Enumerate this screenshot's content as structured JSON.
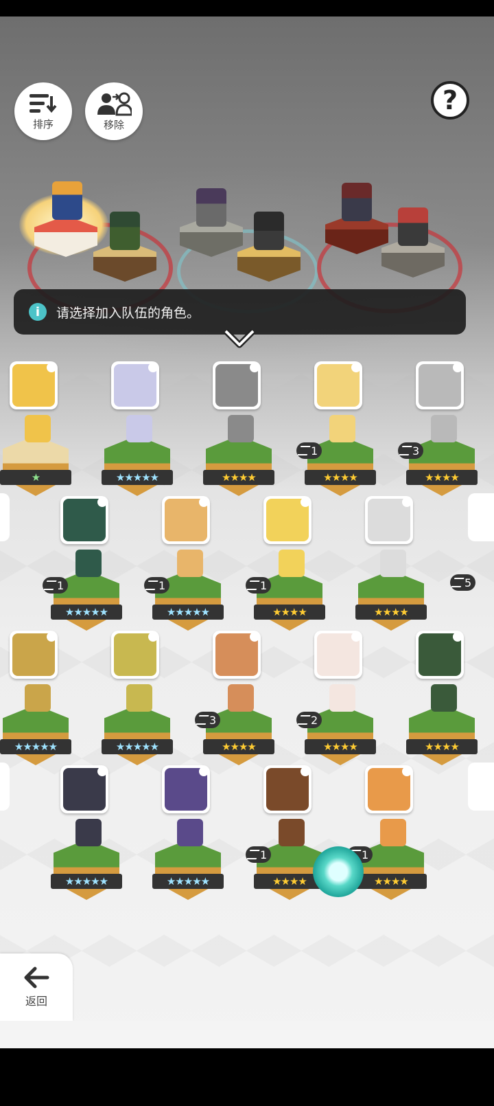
{
  "toolbar": {
    "sort_label": "排序",
    "remove_label": "移除",
    "help_glyph": "?"
  },
  "team_slots": [
    {
      "team_color": "#c8343a",
      "selected": true
    },
    {
      "team_color": "#c8343a",
      "selected": false
    },
    {
      "team_color": "#6fc0c8",
      "selected": false
    },
    {
      "team_color": "#6fc0c8",
      "selected": false
    },
    {
      "team_color": "#c8343a",
      "selected": false
    },
    {
      "team_color": "#c8343a",
      "selected": false
    }
  ],
  "info": {
    "icon": "i",
    "message": "请选择加入队伍的角色。"
  },
  "roster": [
    {
      "stars": "★",
      "star_style": "green",
      "dup": "",
      "base": "sand"
    },
    {
      "stars": "★★★★★",
      "star_style": "rainbow",
      "dup": "",
      "base": "grass"
    },
    {
      "stars": "★★★★",
      "star_style": "gold",
      "dup": "",
      "base": "grass"
    },
    {
      "stars": "★★★★",
      "star_style": "gold",
      "dup": "1",
      "base": "grass"
    },
    {
      "stars": "★★★★",
      "star_style": "gold",
      "dup": "3",
      "base": "grass"
    },
    {
      "stars": "★★★★★",
      "star_style": "rainbow",
      "dup": "1",
      "base": "grass"
    },
    {
      "stars": "★★★★★",
      "star_style": "rainbow",
      "dup": "1",
      "base": "grass"
    },
    {
      "stars": "★★★★",
      "star_style": "gold",
      "dup": "1",
      "base": "grass"
    },
    {
      "stars": "★★★★",
      "star_style": "gold",
      "dup": "",
      "base": "grass"
    },
    {
      "stars": "★★★★★",
      "star_style": "rainbow",
      "dup": "",
      "base": "grass"
    },
    {
      "stars": "★★★★★",
      "star_style": "rainbow",
      "dup": "",
      "base": "grass"
    },
    {
      "stars": "★★★★",
      "star_style": "gold",
      "dup": "3",
      "base": "grass"
    },
    {
      "stars": "★★★★",
      "star_style": "gold",
      "dup": "2",
      "base": "grass"
    },
    {
      "stars": "★★★★",
      "star_style": "gold",
      "dup": "",
      "base": "grass"
    },
    {
      "stars": "★★★★★",
      "star_style": "rainbow",
      "dup": "",
      "base": "grass"
    },
    {
      "stars": "★★★★★",
      "star_style": "rainbow",
      "dup": "",
      "base": "grass"
    },
    {
      "stars": "★★★★",
      "star_style": "gold",
      "dup": "1",
      "base": "grass"
    },
    {
      "stars": "★★★★",
      "star_style": "gold",
      "dup": "1",
      "base": "grass"
    }
  ],
  "edge_dups": [
    "5"
  ],
  "back": {
    "label": "返回"
  }
}
